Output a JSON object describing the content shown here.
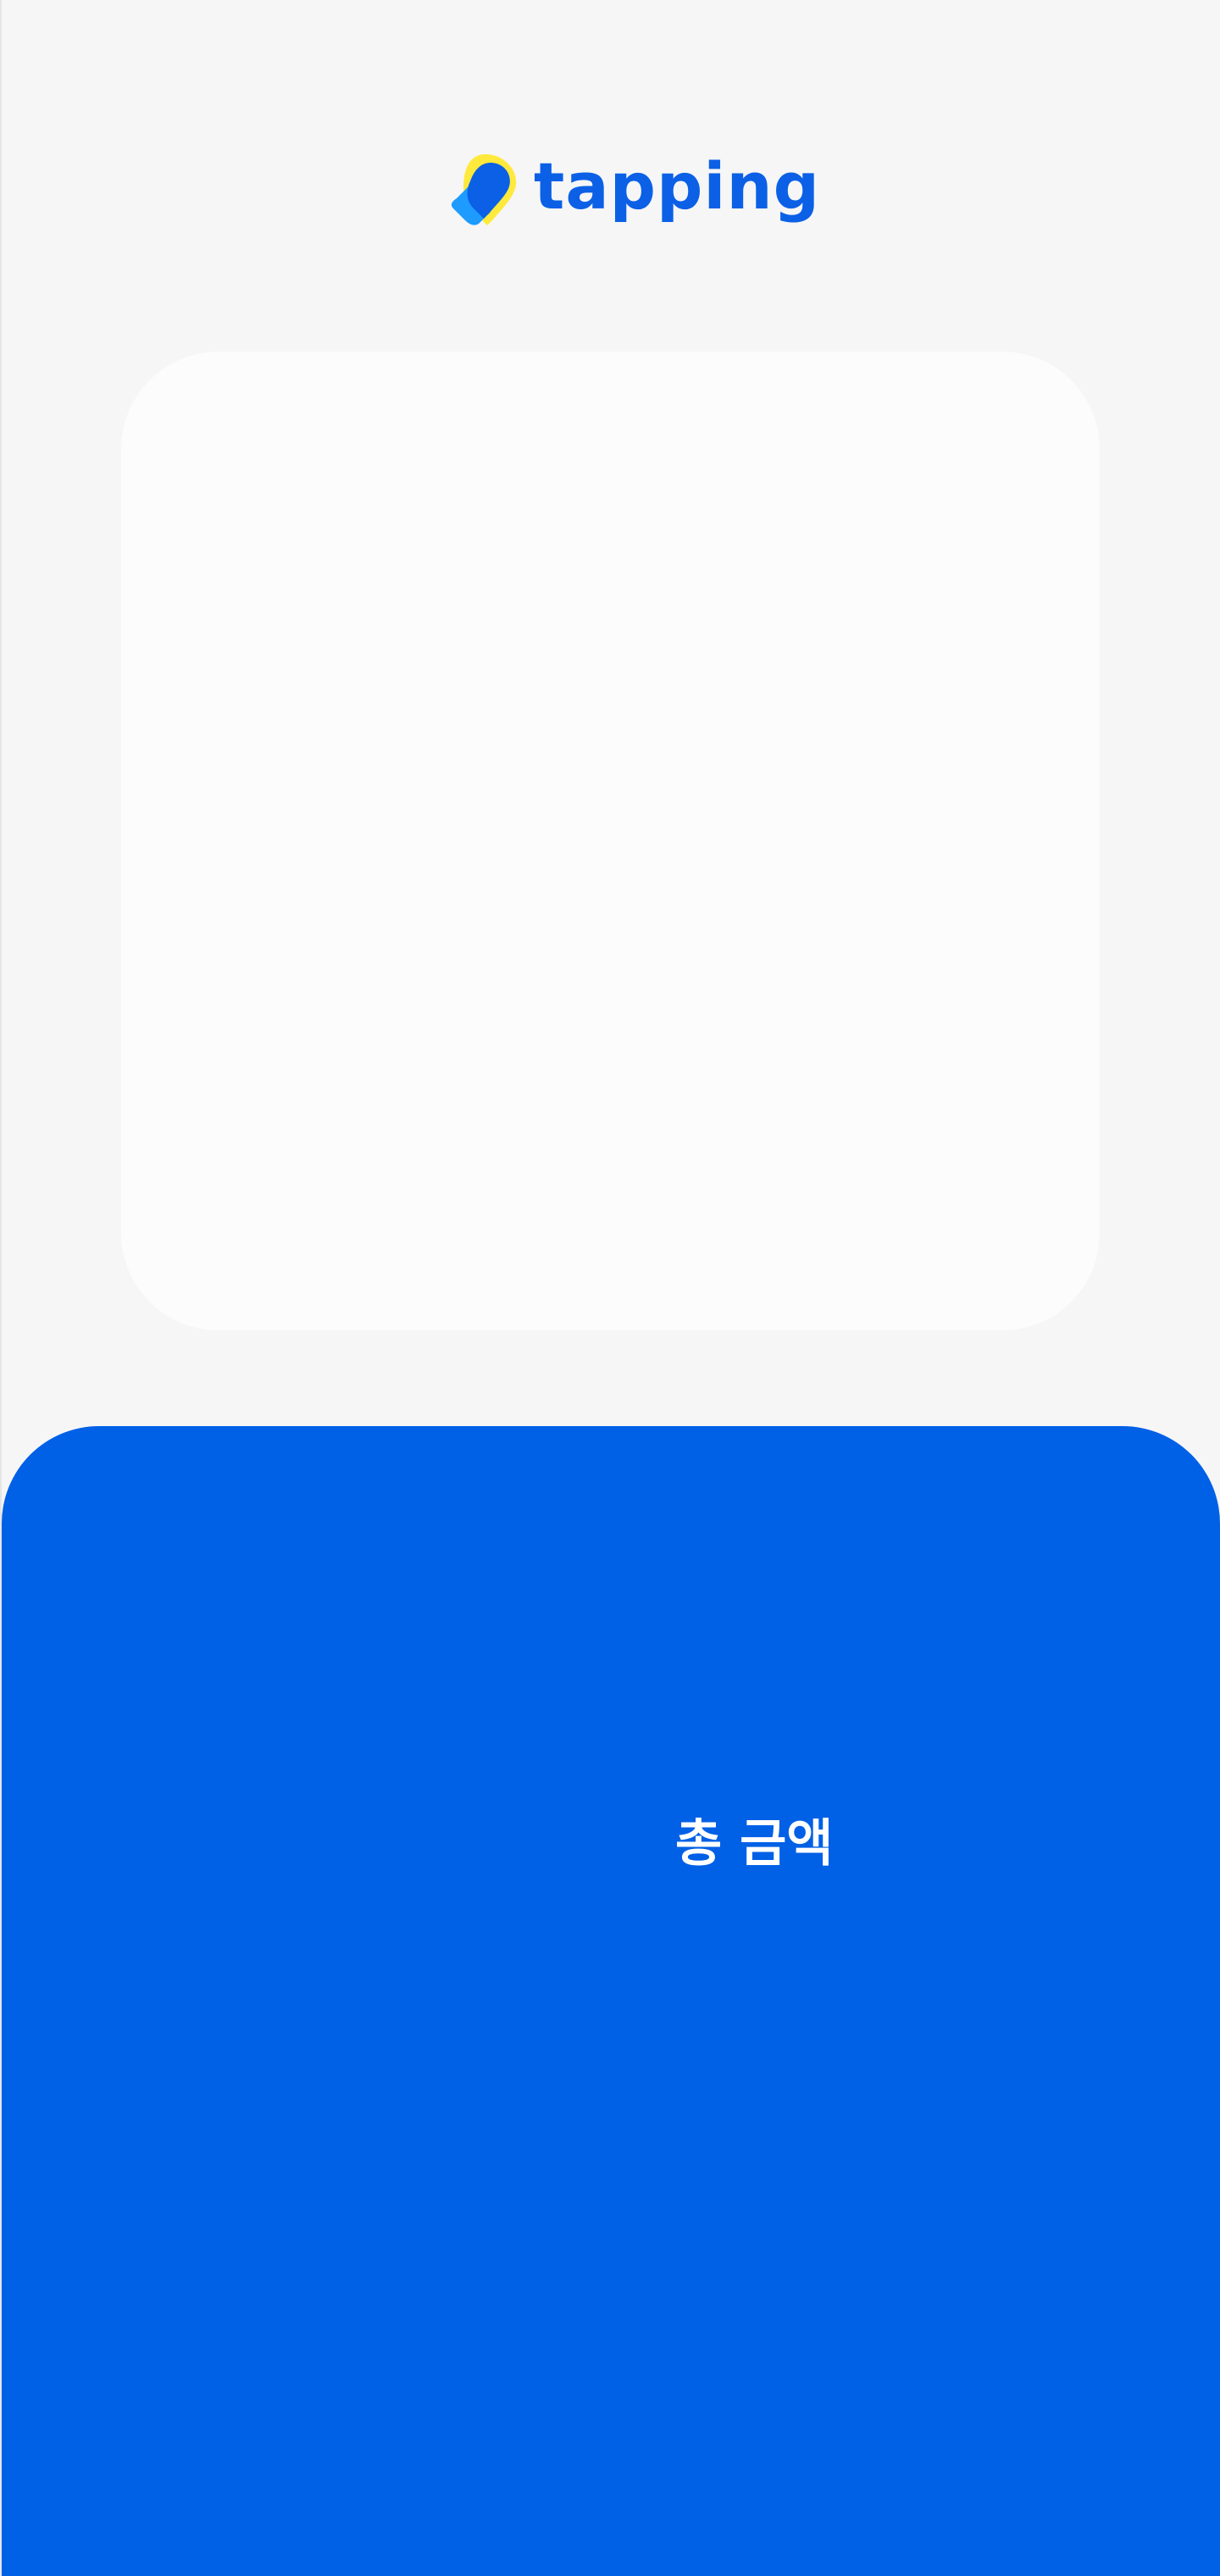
{
  "header": {
    "brand_name": "tapping",
    "logo_icon": "tapping-pin-icon"
  },
  "payment": {
    "total_label": "총 금액"
  },
  "colors": {
    "page_background": "#f6f6f6",
    "card_background": "#fcfcfc",
    "brand_blue": "#0060e6",
    "brand_yellow": "#ffe93c",
    "accent_light_blue": "#1e9bff",
    "text_on_blue": "#ffffff"
  }
}
